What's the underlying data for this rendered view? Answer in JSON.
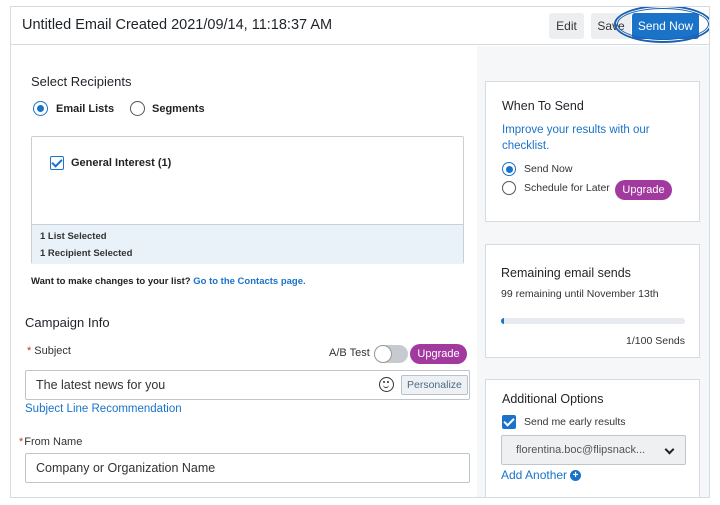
{
  "header": {
    "title": "Untitled Email Created 2021/09/14, 11:18:37 AM",
    "edit_label": "Edit",
    "save_label": "Save",
    "send_now_label": "Send Now"
  },
  "recipients": {
    "title": "Select Recipients",
    "options": [
      "Email Lists",
      "Segments"
    ],
    "selected_option": "Email Lists",
    "lists": [
      {
        "label": "General Interest (1)",
        "checked": true
      }
    ],
    "list_selected_text": "1 List Selected",
    "recipient_selected_text": "1 Recipient Selected",
    "change_prompt": "Want to make changes to your list?",
    "contacts_link": "Go to the Contacts page."
  },
  "campaign": {
    "title": "Campaign Info",
    "subject_label": "Subject",
    "ab_test_label": "A/B Test",
    "ab_test_enabled": false,
    "upgrade_label": "Upgrade",
    "subject_value": "The latest news for you",
    "emoji_icon": "smiley-icon",
    "personalize_label": "Personalize",
    "subject_recommendation_link": "Subject Line Recommendation",
    "from_name_label": "From Name",
    "from_name_placeholder": "Company or Organization Name"
  },
  "when_to_send": {
    "title": "When To Send",
    "improve_link": "Improve your results with our checklist.",
    "options": [
      "Send Now",
      "Schedule for Later"
    ],
    "selected_option": "Send Now",
    "upgrade_label": "Upgrade"
  },
  "remaining": {
    "title": "Remaining email sends",
    "subtitle": "99 remaining until November 13th",
    "used": 1,
    "total": 100,
    "progress_fraction": 0.01,
    "sends_label": "1/100 Sends"
  },
  "additional": {
    "title": "Additional Options",
    "early_results_label": "Send me early results",
    "early_results_checked": true,
    "email_value": "florentina.boc@flipsnack...",
    "add_another_label": "Add Another",
    "add_icon": "plus-circle-icon"
  },
  "colors": {
    "primary": "#1a73c9",
    "upgrade": "#a2399f"
  }
}
